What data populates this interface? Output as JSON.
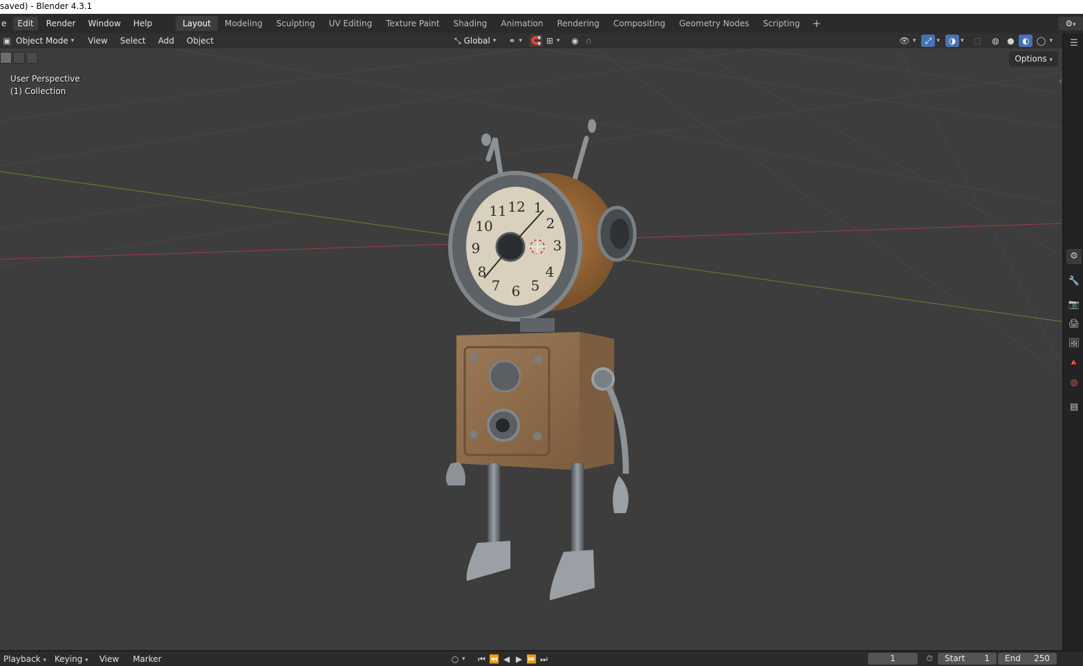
{
  "window": {
    "title": "saved) - Blender 4.3.1"
  },
  "menu": {
    "items": [
      {
        "label": "Edit",
        "highlighted": true
      },
      {
        "label": "Render"
      },
      {
        "label": "Window"
      },
      {
        "label": "Help"
      }
    ]
  },
  "workspaces": {
    "tabs": [
      {
        "label": "Layout",
        "active": true
      },
      {
        "label": "Modeling"
      },
      {
        "label": "Sculpting"
      },
      {
        "label": "UV Editing"
      },
      {
        "label": "Texture Paint"
      },
      {
        "label": "Shading"
      },
      {
        "label": "Animation"
      },
      {
        "label": "Rendering"
      },
      {
        "label": "Compositing"
      },
      {
        "label": "Geometry Nodes"
      },
      {
        "label": "Scripting"
      }
    ],
    "add_label": "+"
  },
  "viewport_header": {
    "mode": "Object Mode",
    "menus": [
      "View",
      "Select",
      "Add",
      "Object"
    ],
    "transform_orientation": "Global",
    "options_label": "Options"
  },
  "viewport": {
    "perspective_label": "User Perspective",
    "collection_label": "(1) Collection",
    "clock_numbers": [
      "12",
      "1",
      "2",
      "3",
      "4",
      "5",
      "6",
      "7",
      "8",
      "9",
      "10",
      "11"
    ]
  },
  "timeline": {
    "menus": [
      "Playback",
      "Keying",
      "View",
      "Marker"
    ],
    "current_frame": "1",
    "start_label": "Start",
    "start_value": "1",
    "end_label": "End",
    "end_value": "250"
  },
  "colors": {
    "viewport_bg": "#3d3d3d",
    "accent": "#4772b3",
    "x_axis": "#a33a44",
    "y_axis": "#5c8a2e"
  }
}
